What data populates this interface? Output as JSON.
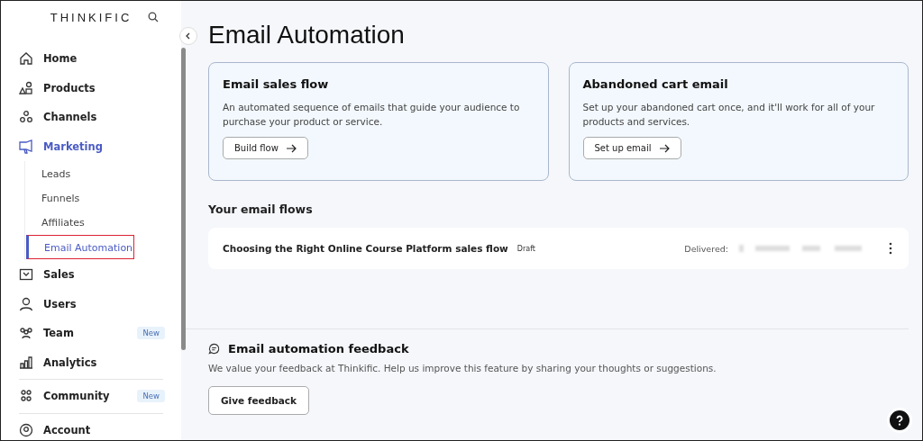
{
  "sidebar": {
    "logo": "THINKIFIC",
    "items": [
      {
        "label": "Home",
        "kind": "home",
        "selected": false
      },
      {
        "label": "Products",
        "kind": "shapes",
        "selected": false
      },
      {
        "label": "Channels",
        "kind": "circles",
        "selected": false
      },
      {
        "label": "Marketing",
        "kind": "megaphone",
        "selected": true,
        "children": [
          {
            "label": "Leads",
            "selected": false
          },
          {
            "label": "Funnels",
            "selected": false
          },
          {
            "label": "Affiliates",
            "selected": false
          },
          {
            "label": "Email Automation",
            "selected": true
          }
        ]
      },
      {
        "label": "Sales",
        "kind": "inbox",
        "selected": false
      },
      {
        "label": "Users",
        "kind": "user",
        "selected": false
      },
      {
        "label": "Team",
        "kind": "team",
        "selected": false,
        "badge": "New"
      },
      {
        "label": "Analytics",
        "kind": "chart",
        "selected": false
      },
      {
        "label": "Community",
        "kind": "community",
        "selected": false,
        "badge": "New",
        "divider": true
      },
      {
        "label": "Account",
        "kind": "account",
        "selected": false,
        "divider": true
      }
    ]
  },
  "page": {
    "title": "Email Automation",
    "cards": [
      {
        "title": "Email sales flow",
        "text": "An automated sequence of emails that guide your audience to purchase your product or service.",
        "button": "Build flow"
      },
      {
        "title": "Abandoned cart email",
        "text": "Set up your abandoned cart once, and it'll work for all of your products and services.",
        "button": "Set up email"
      }
    ],
    "flows_heading": "Your email flows",
    "flows": [
      {
        "name": "Choosing the Right Online Course Platform sales flow",
        "status": "Draft",
        "stats_label": "Delivered:"
      }
    ],
    "feedback": {
      "heading": "Email automation feedback",
      "text": "We value your feedback at Thinkific. Help us improve this feature by sharing your thoughts or suggestions.",
      "button": "Give feedback"
    }
  }
}
